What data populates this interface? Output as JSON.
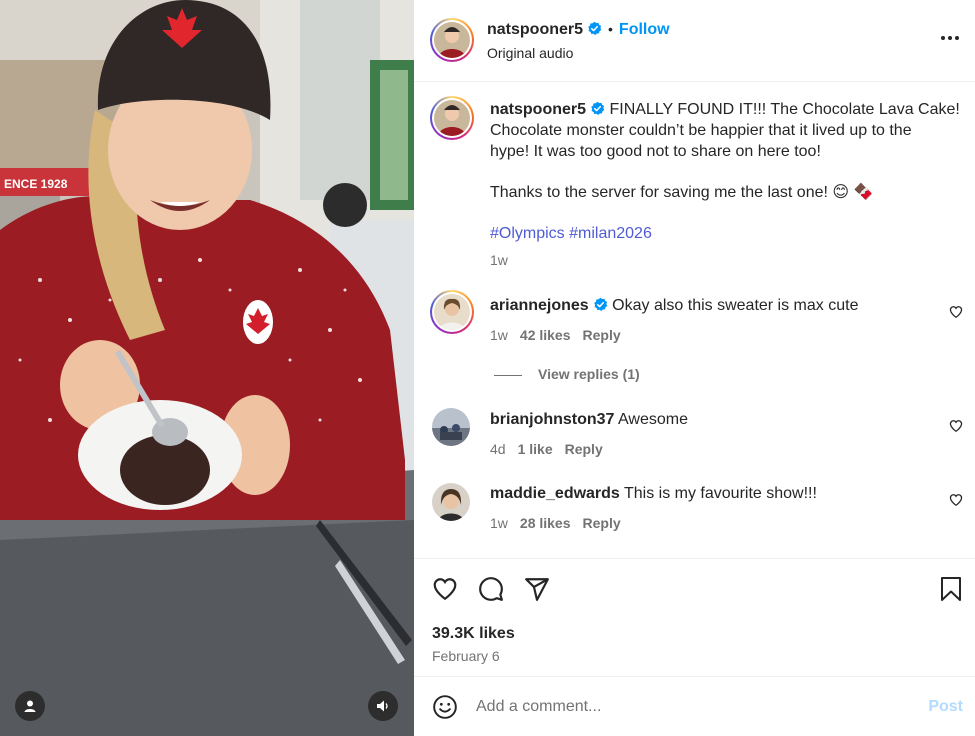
{
  "media": {
    "overlay_text": "ENCE 1928",
    "person_icon": "person-icon",
    "sound_icon": "speaker-icon"
  },
  "header": {
    "username": "natspooner5",
    "separator": "•",
    "follow_label": "Follow",
    "subtitle": "Original audio",
    "more_icon": "more-options-icon"
  },
  "caption": {
    "username": "natspooner5",
    "line1": "FINALLY FOUND IT!!! The Chocolate Lava Cake!",
    "line2": "Chocolate monster couldn’t be happier that it lived up to the",
    "line3": "hype! It was too good not to share on here too!",
    "line4": "Thanks to the server for saving me the last one! 😊 🍫",
    "hashtags": "#Olympics #milan2026",
    "age": "1w"
  },
  "comments": [
    {
      "username": "ariannejones",
      "verified": true,
      "text": "Okay also this sweater is max cute",
      "age": "1w",
      "likes": "42 likes",
      "reply": "Reply"
    },
    {
      "username": "brianjohnston37",
      "verified": false,
      "text": "Awesome",
      "age": "4d",
      "likes": "1 like",
      "reply": "Reply"
    },
    {
      "username": "maddie_edwards",
      "verified": false,
      "text": "This is my favourite show!!!",
      "age": "1w",
      "likes": "28 likes",
      "reply": "Reply"
    }
  ],
  "view_replies": "View replies (1)",
  "actions": {
    "likes": "39.3K likes",
    "date": "February 6"
  },
  "composer": {
    "placeholder": "Add a comment...",
    "post_label": "Post"
  },
  "colors": {
    "link_blue": "#0095f6",
    "hashtag": "#4f5bd5",
    "sweater_red": "#9b1c22",
    "post_disabled": "#b3dbff"
  }
}
